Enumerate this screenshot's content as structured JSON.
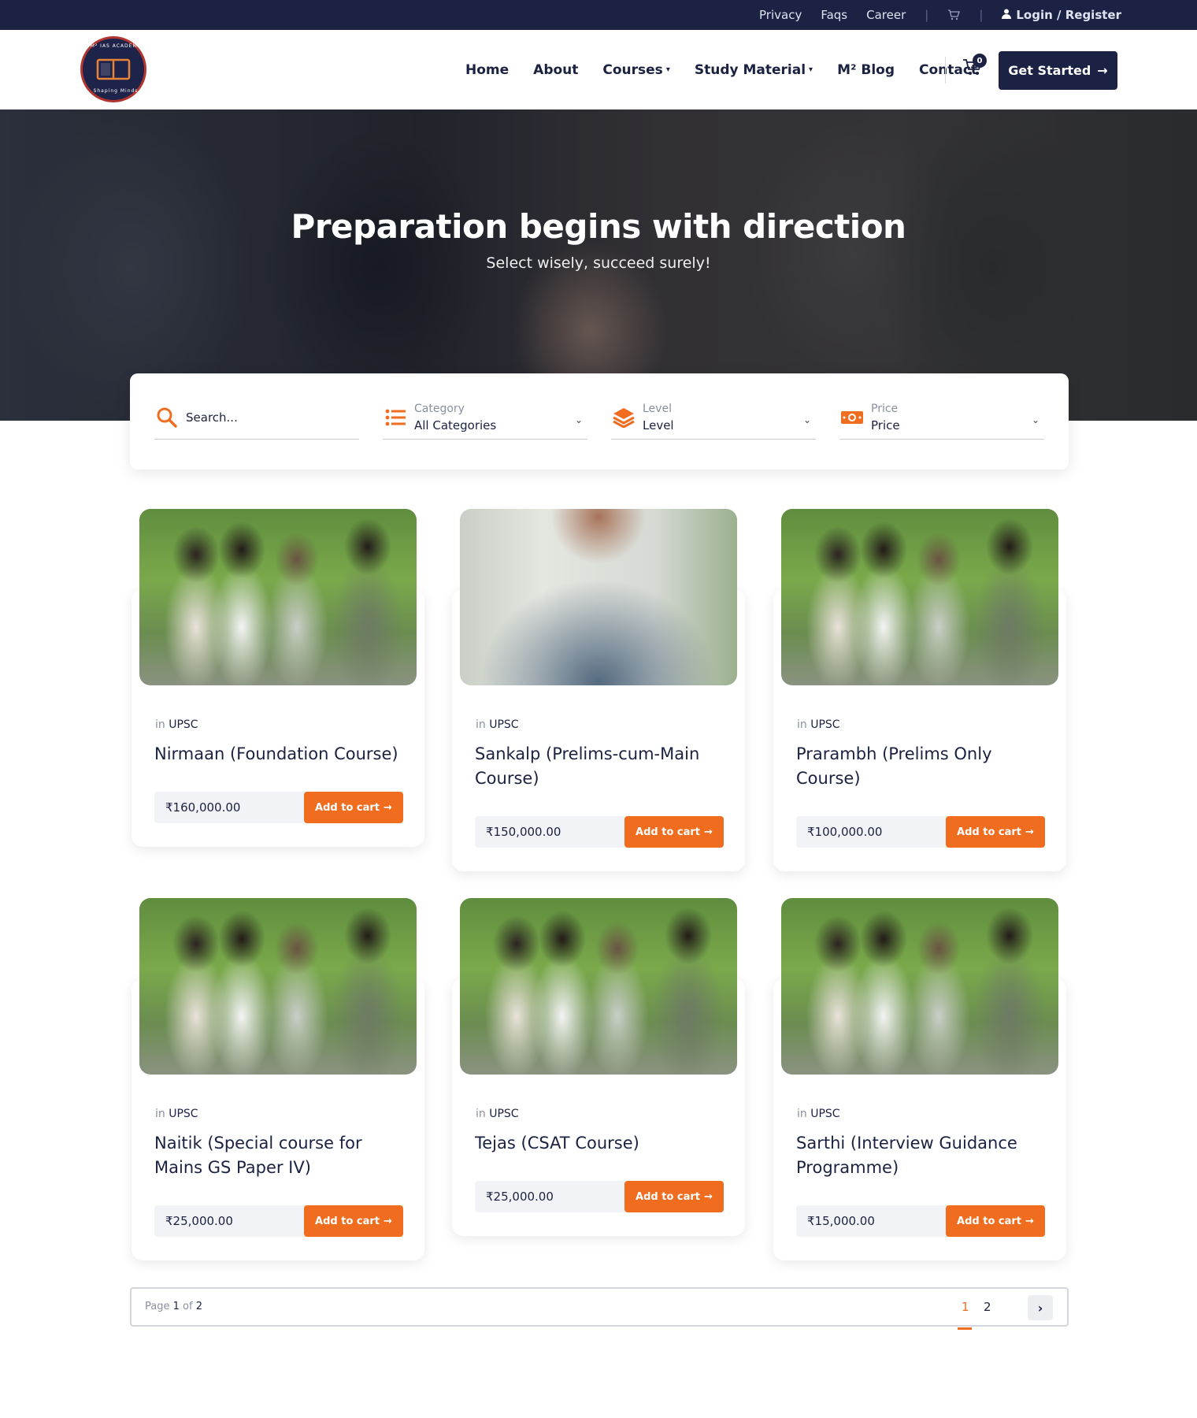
{
  "topbar": {
    "links": [
      "Privacy",
      "Faqs",
      "Career"
    ],
    "login_label": "Login / Register"
  },
  "header": {
    "logo_text_top": "M² IAS ACADEMY",
    "logo_text_bottom": "Shaping Minds",
    "nav": [
      {
        "label": "Home",
        "dropdown": false
      },
      {
        "label": "About",
        "dropdown": false
      },
      {
        "label": "Courses",
        "dropdown": true
      },
      {
        "label": "Study Material",
        "dropdown": true
      },
      {
        "label": "M² Blog",
        "dropdown": false
      },
      {
        "label": "Contact",
        "dropdown": false
      }
    ],
    "cart_count": "0",
    "cta_label": "Get Started"
  },
  "hero": {
    "title": "Preparation begins with direction",
    "subtitle": "Select wisely, succeed surely!"
  },
  "filters": {
    "search_placeholder": "Search...",
    "category": {
      "label": "Category",
      "value": "All Categories"
    },
    "level": {
      "label": "Level",
      "value": "Level"
    },
    "price": {
      "label": "Price",
      "value": "Price"
    }
  },
  "courses": [
    {
      "tag": "UPSC",
      "title": "Nirmaan (Foundation Course)",
      "price": "₹160,000.00",
      "image": "group-students"
    },
    {
      "tag": "UPSC",
      "title": "Sankalp (Prelims-cum-Main Course)",
      "price": "₹150,000.00",
      "image": "single-student"
    },
    {
      "tag": "UPSC",
      "title": "Prarambh (Prelims Only Course)",
      "price": "₹100,000.00",
      "image": "group-students"
    },
    {
      "tag": "UPSC",
      "title": "Naitik (Special course for Mains GS Paper IV)",
      "price": "₹25,000.00",
      "image": "group-students"
    },
    {
      "tag": "UPSC",
      "title": "Tejas (CSAT Course)",
      "price": "₹25,000.00",
      "image": "group-students"
    },
    {
      "tag": "UPSC",
      "title": "Sarthi (Interview Guidance Programme)",
      "price": "₹15,000.00",
      "image": "group-students"
    }
  ],
  "card_labels": {
    "in": "in",
    "add_to_cart": "Add to cart"
  },
  "pagination": {
    "page_word": "Page",
    "current": "1",
    "of_word": "of",
    "total": "2",
    "pages": [
      "1",
      "2"
    ]
  },
  "colors": {
    "navy": "#1b2243",
    "accent": "#f06d1f"
  }
}
